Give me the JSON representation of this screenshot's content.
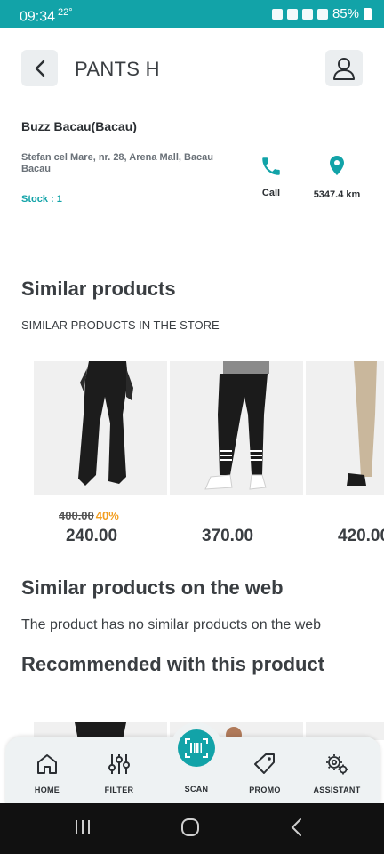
{
  "status_bar": {
    "time": "09:34",
    "temp": "22°",
    "battery": "85%"
  },
  "header": {
    "title": "PANTS H"
  },
  "store": {
    "name": "Buzz Bacau(Bacau)",
    "address": "Stefan cel Mare, nr. 28, Arena Mall, Bacau Bacau",
    "stock": "Stock : 1",
    "call_label": "Call",
    "distance": "5347.4 km"
  },
  "similar": {
    "title": "Similar products",
    "subtitle": "SIMILAR PRODUCTS IN THE STORE",
    "items": [
      {
        "old_price": "400.00",
        "discount": "40%",
        "price": "240.00"
      },
      {
        "price": "370.00"
      },
      {
        "price": "420.00"
      }
    ]
  },
  "web": {
    "title": "Similar products on the web",
    "message": "The product has no similar products on the web"
  },
  "recommended": {
    "title": "Recommended with this product"
  },
  "bottom_nav": {
    "home": "HOME",
    "filter": "FILTER",
    "scan": "SCAN",
    "promo": "PROMO",
    "assistant": "ASSISTANT"
  },
  "colors": {
    "accent": "#12a3a8",
    "discount": "#f29d1f",
    "text": "#2b2f33"
  }
}
